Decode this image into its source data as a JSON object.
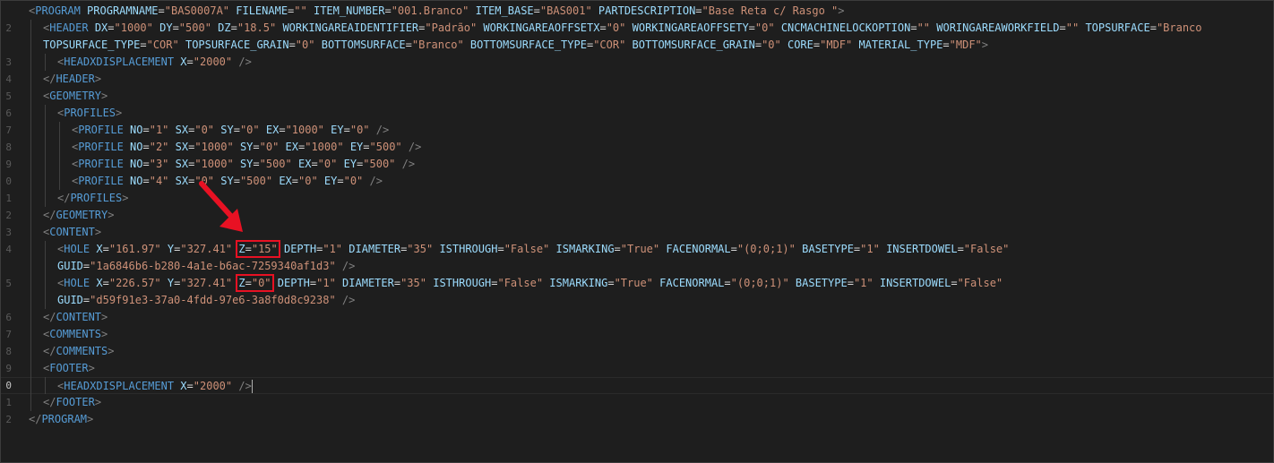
{
  "lines": [
    {
      "n": "",
      "indent": 0,
      "tokens": [
        [
          "g",
          "<"
        ],
        [
          "t",
          "PROGRAM"
        ],
        [
          "p",
          " "
        ],
        [
          "a",
          "PROGRAMNAME"
        ],
        [
          "p",
          "="
        ],
        [
          "v",
          "\"BAS0007A\""
        ],
        [
          "p",
          " "
        ],
        [
          "a",
          "FILENAME"
        ],
        [
          "p",
          "="
        ],
        [
          "v",
          "\"\""
        ],
        [
          "p",
          " "
        ],
        [
          "a",
          "ITEM_NUMBER"
        ],
        [
          "p",
          "="
        ],
        [
          "v",
          "\"001.Branco\""
        ],
        [
          "p",
          " "
        ],
        [
          "a",
          "ITEM_BASE"
        ],
        [
          "p",
          "="
        ],
        [
          "v",
          "\"BAS001\""
        ],
        [
          "p",
          " "
        ],
        [
          "a",
          "PARTDESCRIPTION"
        ],
        [
          "p",
          "="
        ],
        [
          "v",
          "\"Base Reta c/ Rasgo \""
        ],
        [
          "g",
          ">"
        ]
      ]
    },
    {
      "n": "2",
      "indent": 1,
      "tokens": [
        [
          "g",
          "<"
        ],
        [
          "t",
          "HEADER"
        ],
        [
          "p",
          " "
        ],
        [
          "a",
          "DX"
        ],
        [
          "p",
          "="
        ],
        [
          "v",
          "\"1000\""
        ],
        [
          "p",
          " "
        ],
        [
          "a",
          "DY"
        ],
        [
          "p",
          "="
        ],
        [
          "v",
          "\"500\""
        ],
        [
          "p",
          " "
        ],
        [
          "a",
          "DZ"
        ],
        [
          "p",
          "="
        ],
        [
          "v",
          "\"18.5\""
        ],
        [
          "p",
          " "
        ],
        [
          "a",
          "WORKINGAREAIDENTIFIER"
        ],
        [
          "p",
          "="
        ],
        [
          "v",
          "\"Padrão\""
        ],
        [
          "p",
          " "
        ],
        [
          "a",
          "WORKINGAREAOFFSETX"
        ],
        [
          "p",
          "="
        ],
        [
          "v",
          "\"0\""
        ],
        [
          "p",
          " "
        ],
        [
          "a",
          "WORKINGAREAOFFSETY"
        ],
        [
          "p",
          "="
        ],
        [
          "v",
          "\"0\""
        ],
        [
          "p",
          " "
        ],
        [
          "a",
          "CNCMACHINELOCKOPTION"
        ],
        [
          "p",
          "="
        ],
        [
          "v",
          "\"\""
        ],
        [
          "p",
          " "
        ],
        [
          "a",
          "WORINGAREAWORKFIELD"
        ],
        [
          "p",
          "="
        ],
        [
          "v",
          "\"\""
        ],
        [
          "p",
          " "
        ],
        [
          "a",
          "TOPSURFACE"
        ],
        [
          "p",
          "="
        ],
        [
          "v",
          "\"Branco"
        ]
      ]
    },
    {
      "n": "",
      "indent": 1,
      "tokens": [
        [
          "a",
          "TOPSURFACE_TYPE"
        ],
        [
          "p",
          "="
        ],
        [
          "v",
          "\"COR\""
        ],
        [
          "p",
          " "
        ],
        [
          "a",
          "TOPSURFACE_GRAIN"
        ],
        [
          "p",
          "="
        ],
        [
          "v",
          "\"0\""
        ],
        [
          "p",
          " "
        ],
        [
          "a",
          "BOTTOMSURFACE"
        ],
        [
          "p",
          "="
        ],
        [
          "v",
          "\"Branco\""
        ],
        [
          "p",
          " "
        ],
        [
          "a",
          "BOTTOMSURFACE_TYPE"
        ],
        [
          "p",
          "="
        ],
        [
          "v",
          "\"COR\""
        ],
        [
          "p",
          " "
        ],
        [
          "a",
          "BOTTOMSURFACE_GRAIN"
        ],
        [
          "p",
          "="
        ],
        [
          "v",
          "\"0\""
        ],
        [
          "p",
          " "
        ],
        [
          "a",
          "CORE"
        ],
        [
          "p",
          "="
        ],
        [
          "v",
          "\"MDF\""
        ],
        [
          "p",
          " "
        ],
        [
          "a",
          "MATERIAL_TYPE"
        ],
        [
          "p",
          "="
        ],
        [
          "v",
          "\"MDF\""
        ],
        [
          "g",
          ">"
        ]
      ]
    },
    {
      "n": "3",
      "indent": 2,
      "tokens": [
        [
          "g",
          "<"
        ],
        [
          "t",
          "HEADXDISPLACEMENT"
        ],
        [
          "p",
          " "
        ],
        [
          "a",
          "X"
        ],
        [
          "p",
          "="
        ],
        [
          "v",
          "\"2000\""
        ],
        [
          "p",
          " "
        ],
        [
          "g",
          "/>"
        ]
      ]
    },
    {
      "n": "4",
      "indent": 1,
      "tokens": [
        [
          "g",
          "</"
        ],
        [
          "t",
          "HEADER"
        ],
        [
          "g",
          ">"
        ]
      ]
    },
    {
      "n": "5",
      "indent": 1,
      "tokens": [
        [
          "g",
          "<"
        ],
        [
          "t",
          "GEOMETRY"
        ],
        [
          "g",
          ">"
        ]
      ]
    },
    {
      "n": "6",
      "indent": 2,
      "tokens": [
        [
          "g",
          "<"
        ],
        [
          "t",
          "PROFILES"
        ],
        [
          "g",
          ">"
        ]
      ]
    },
    {
      "n": "7",
      "indent": 3,
      "tokens": [
        [
          "g",
          "<"
        ],
        [
          "t",
          "PROFILE"
        ],
        [
          "p",
          " "
        ],
        [
          "a",
          "NO"
        ],
        [
          "p",
          "="
        ],
        [
          "v",
          "\"1\""
        ],
        [
          "p",
          " "
        ],
        [
          "a",
          "SX"
        ],
        [
          "p",
          "="
        ],
        [
          "v",
          "\"0\""
        ],
        [
          "p",
          " "
        ],
        [
          "a",
          "SY"
        ],
        [
          "p",
          "="
        ],
        [
          "v",
          "\"0\""
        ],
        [
          "p",
          " "
        ],
        [
          "a",
          "EX"
        ],
        [
          "p",
          "="
        ],
        [
          "v",
          "\"1000\""
        ],
        [
          "p",
          " "
        ],
        [
          "a",
          "EY"
        ],
        [
          "p",
          "="
        ],
        [
          "v",
          "\"0\""
        ],
        [
          "p",
          " "
        ],
        [
          "g",
          "/>"
        ]
      ]
    },
    {
      "n": "8",
      "indent": 3,
      "tokens": [
        [
          "g",
          "<"
        ],
        [
          "t",
          "PROFILE"
        ],
        [
          "p",
          " "
        ],
        [
          "a",
          "NO"
        ],
        [
          "p",
          "="
        ],
        [
          "v",
          "\"2\""
        ],
        [
          "p",
          " "
        ],
        [
          "a",
          "SX"
        ],
        [
          "p",
          "="
        ],
        [
          "v",
          "\"1000\""
        ],
        [
          "p",
          " "
        ],
        [
          "a",
          "SY"
        ],
        [
          "p",
          "="
        ],
        [
          "v",
          "\"0\""
        ],
        [
          "p",
          " "
        ],
        [
          "a",
          "EX"
        ],
        [
          "p",
          "="
        ],
        [
          "v",
          "\"1000\""
        ],
        [
          "p",
          " "
        ],
        [
          "a",
          "EY"
        ],
        [
          "p",
          "="
        ],
        [
          "v",
          "\"500\""
        ],
        [
          "p",
          " "
        ],
        [
          "g",
          "/>"
        ]
      ]
    },
    {
      "n": "9",
      "indent": 3,
      "tokens": [
        [
          "g",
          "<"
        ],
        [
          "t",
          "PROFILE"
        ],
        [
          "p",
          " "
        ],
        [
          "a",
          "NO"
        ],
        [
          "p",
          "="
        ],
        [
          "v",
          "\"3\""
        ],
        [
          "p",
          " "
        ],
        [
          "a",
          "SX"
        ],
        [
          "p",
          "="
        ],
        [
          "v",
          "\"1000\""
        ],
        [
          "p",
          " "
        ],
        [
          "a",
          "SY"
        ],
        [
          "p",
          "="
        ],
        [
          "v",
          "\"500\""
        ],
        [
          "p",
          " "
        ],
        [
          "a",
          "EX"
        ],
        [
          "p",
          "="
        ],
        [
          "v",
          "\"0\""
        ],
        [
          "p",
          " "
        ],
        [
          "a",
          "EY"
        ],
        [
          "p",
          "="
        ],
        [
          "v",
          "\"500\""
        ],
        [
          "p",
          " "
        ],
        [
          "g",
          "/>"
        ]
      ]
    },
    {
      "n": "0",
      "indent": 3,
      "tokens": [
        [
          "g",
          "<"
        ],
        [
          "t",
          "PROFILE"
        ],
        [
          "p",
          " "
        ],
        [
          "a",
          "NO"
        ],
        [
          "p",
          "="
        ],
        [
          "v",
          "\"4\""
        ],
        [
          "p",
          " "
        ],
        [
          "a",
          "SX"
        ],
        [
          "p",
          "="
        ],
        [
          "v",
          "\"0\""
        ],
        [
          "p",
          " "
        ],
        [
          "a",
          "SY"
        ],
        [
          "p",
          "="
        ],
        [
          "v",
          "\"500\""
        ],
        [
          "p",
          " "
        ],
        [
          "a",
          "EX"
        ],
        [
          "p",
          "="
        ],
        [
          "v",
          "\"0\""
        ],
        [
          "p",
          " "
        ],
        [
          "a",
          "EY"
        ],
        [
          "p",
          "="
        ],
        [
          "v",
          "\"0\""
        ],
        [
          "p",
          " "
        ],
        [
          "g",
          "/>"
        ]
      ]
    },
    {
      "n": "1",
      "indent": 2,
      "tokens": [
        [
          "g",
          "</"
        ],
        [
          "t",
          "PROFILES"
        ],
        [
          "g",
          ">"
        ]
      ]
    },
    {
      "n": "2",
      "indent": 1,
      "tokens": [
        [
          "g",
          "</"
        ],
        [
          "t",
          "GEOMETRY"
        ],
        [
          "g",
          ">"
        ]
      ]
    },
    {
      "n": "3",
      "indent": 1,
      "tokens": [
        [
          "g",
          "<"
        ],
        [
          "t",
          "CONTENT"
        ],
        [
          "g",
          ">"
        ]
      ]
    },
    {
      "n": "4",
      "indent": 2,
      "tokens": [
        [
          "g",
          "<"
        ],
        [
          "t",
          "HOLE"
        ],
        [
          "p",
          " "
        ],
        [
          "a",
          "X"
        ],
        [
          "p",
          "="
        ],
        [
          "v",
          "\"161.97\""
        ],
        [
          "p",
          " "
        ],
        [
          "a",
          "Y"
        ],
        [
          "p",
          "="
        ],
        [
          "v",
          "\"327.41\""
        ],
        [
          "p",
          " "
        ],
        [
          "box",
          [
            [
              "a",
              "Z"
            ],
            [
              "p",
              "="
            ],
            [
              "v",
              "\"15\""
            ]
          ]
        ],
        [
          "p",
          " "
        ],
        [
          "a",
          "DEPTH"
        ],
        [
          "p",
          "="
        ],
        [
          "v",
          "\"1\""
        ],
        [
          "p",
          " "
        ],
        [
          "a",
          "DIAMETER"
        ],
        [
          "p",
          "="
        ],
        [
          "v",
          "\"35\""
        ],
        [
          "p",
          " "
        ],
        [
          "a",
          "ISTHROUGH"
        ],
        [
          "p",
          "="
        ],
        [
          "v",
          "\"False\""
        ],
        [
          "p",
          " "
        ],
        [
          "a",
          "ISMARKING"
        ],
        [
          "p",
          "="
        ],
        [
          "v",
          "\"True\""
        ],
        [
          "p",
          " "
        ],
        [
          "a",
          "FACENORMAL"
        ],
        [
          "p",
          "="
        ],
        [
          "v",
          "\"(0;0;1)\""
        ],
        [
          "p",
          " "
        ],
        [
          "a",
          "BASETYPE"
        ],
        [
          "p",
          "="
        ],
        [
          "v",
          "\"1\""
        ],
        [
          "p",
          " "
        ],
        [
          "a",
          "INSERTDOWEL"
        ],
        [
          "p",
          "="
        ],
        [
          "v",
          "\"False\""
        ]
      ]
    },
    {
      "n": "",
      "indent": 2,
      "tokens": [
        [
          "a",
          "GUID"
        ],
        [
          "p",
          "="
        ],
        [
          "v",
          "\"1a6846b6-b280-4a1e-b6ac-7259340af1d3\""
        ],
        [
          "p",
          " "
        ],
        [
          "g",
          "/>"
        ]
      ]
    },
    {
      "n": "5",
      "indent": 2,
      "tokens": [
        [
          "g",
          "<"
        ],
        [
          "t",
          "HOLE"
        ],
        [
          "p",
          " "
        ],
        [
          "a",
          "X"
        ],
        [
          "p",
          "="
        ],
        [
          "v",
          "\"226.57\""
        ],
        [
          "p",
          " "
        ],
        [
          "a",
          "Y"
        ],
        [
          "p",
          "="
        ],
        [
          "v",
          "\"327.41\""
        ],
        [
          "p",
          " "
        ],
        [
          "box",
          [
            [
              "a",
              "Z"
            ],
            [
              "p",
              "="
            ],
            [
              "v",
              "\"0\""
            ]
          ]
        ],
        [
          "p",
          " "
        ],
        [
          "a",
          "DEPTH"
        ],
        [
          "p",
          "="
        ],
        [
          "v",
          "\"1\""
        ],
        [
          "p",
          " "
        ],
        [
          "a",
          "DIAMETER"
        ],
        [
          "p",
          "="
        ],
        [
          "v",
          "\"35\""
        ],
        [
          "p",
          " "
        ],
        [
          "a",
          "ISTHROUGH"
        ],
        [
          "p",
          "="
        ],
        [
          "v",
          "\"False\""
        ],
        [
          "p",
          " "
        ],
        [
          "a",
          "ISMARKING"
        ],
        [
          "p",
          "="
        ],
        [
          "v",
          "\"True\""
        ],
        [
          "p",
          " "
        ],
        [
          "a",
          "FACENORMAL"
        ],
        [
          "p",
          "="
        ],
        [
          "v",
          "\"(0;0;1)\""
        ],
        [
          "p",
          " "
        ],
        [
          "a",
          "BASETYPE"
        ],
        [
          "p",
          "="
        ],
        [
          "v",
          "\"1\""
        ],
        [
          "p",
          " "
        ],
        [
          "a",
          "INSERTDOWEL"
        ],
        [
          "p",
          "="
        ],
        [
          "v",
          "\"False\""
        ]
      ]
    },
    {
      "n": "",
      "indent": 2,
      "tokens": [
        [
          "a",
          "GUID"
        ],
        [
          "p",
          "="
        ],
        [
          "v",
          "\"d59f91e3-37a0-4fdd-97e6-3a8f0d8c9238\""
        ],
        [
          "p",
          " "
        ],
        [
          "g",
          "/>"
        ]
      ]
    },
    {
      "n": "6",
      "indent": 1,
      "tokens": [
        [
          "g",
          "</"
        ],
        [
          "t",
          "CONTENT"
        ],
        [
          "g",
          ">"
        ]
      ]
    },
    {
      "n": "7",
      "indent": 1,
      "tokens": [
        [
          "g",
          "<"
        ],
        [
          "t",
          "COMMENTS"
        ],
        [
          "g",
          ">"
        ]
      ]
    },
    {
      "n": "8",
      "indent": 1,
      "tokens": [
        [
          "g",
          "</"
        ],
        [
          "t",
          "COMMENTS"
        ],
        [
          "g",
          ">"
        ]
      ]
    },
    {
      "n": "9",
      "indent": 1,
      "tokens": [
        [
          "g",
          "<"
        ],
        [
          "t",
          "FOOTER"
        ],
        [
          "g",
          ">"
        ]
      ]
    },
    {
      "n": "0",
      "indent": 2,
      "current": true,
      "tokens": [
        [
          "g",
          "<"
        ],
        [
          "t",
          "HEADXDISPLACEMENT"
        ],
        [
          "p",
          " "
        ],
        [
          "a",
          "X"
        ],
        [
          "p",
          "="
        ],
        [
          "v",
          "\"2000\""
        ],
        [
          "p",
          " "
        ],
        [
          "g",
          "/>"
        ]
      ]
    },
    {
      "n": "1",
      "indent": 1,
      "tokens": [
        [
          "g",
          "</"
        ],
        [
          "t",
          "FOOTER"
        ],
        [
          "g",
          ">"
        ]
      ]
    },
    {
      "n": "2",
      "indent": 0,
      "tokens": [
        [
          "g",
          "</"
        ],
        [
          "t",
          "PROGRAM"
        ],
        [
          "g",
          ">"
        ]
      ]
    }
  ],
  "colors": {
    "background": "#1e1e1e",
    "tag": "#569cd6",
    "attr": "#9cdcfe",
    "value": "#ce9178",
    "highlight_box": "#e81123",
    "arrow": "#e81123"
  }
}
